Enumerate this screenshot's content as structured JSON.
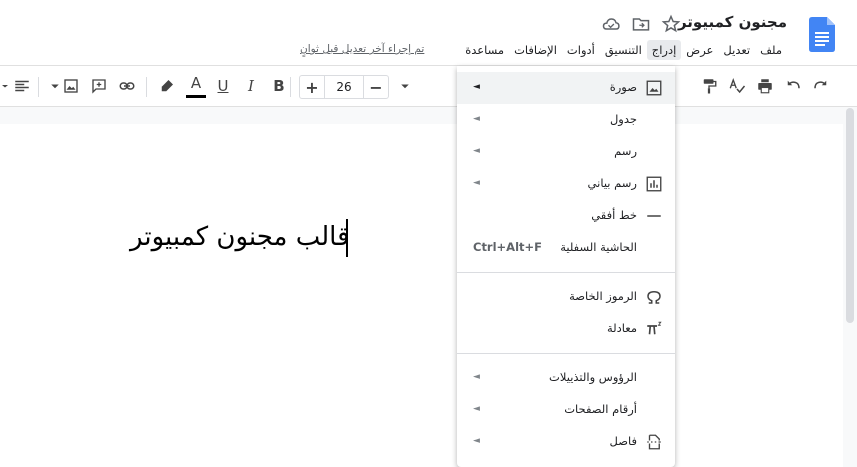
{
  "header": {
    "title": "مجنون كمبيوتر",
    "last_edit": "تم إجراء آخر تعديل قبل ثوانٍ"
  },
  "menu": {
    "items": [
      {
        "label": "ملف"
      },
      {
        "label": "تعديل"
      },
      {
        "label": "عرض"
      },
      {
        "label": "إدراج",
        "active": true
      },
      {
        "label": "التنسيق"
      },
      {
        "label": "أدوات"
      },
      {
        "label": "الإضافات"
      },
      {
        "label": "مساعدة"
      }
    ]
  },
  "toolbar": {
    "font_size": "26",
    "decrease_label": "−",
    "increase_label": "+",
    "bold_label": "B",
    "italic_label": "I",
    "underline_label": "U",
    "text_color_label": "A"
  },
  "document": {
    "body_text": "قالب مجنون كمبيوتر"
  },
  "insert_menu": {
    "items": [
      {
        "label": "صورة",
        "icon": "image-icon",
        "submenu": true
      },
      {
        "label": "جدول",
        "submenu": true
      },
      {
        "label": "رسم",
        "submenu": true
      },
      {
        "label": "رسم بياني",
        "icon": "chart-icon",
        "submenu": true
      },
      {
        "label": "خط أفقي",
        "icon": "horizontal-line-icon"
      },
      {
        "label": "الحاشية السفلية",
        "shortcut": "Ctrl+Alt+F"
      },
      {
        "label": "الرموز الخاصة",
        "icon": "omega-icon"
      },
      {
        "label": "معادلة",
        "icon": "pi-icon"
      },
      {
        "label": "الرؤوس والتذييلات",
        "submenu": true
      },
      {
        "label": "أرقام الصفحات",
        "submenu": true
      },
      {
        "label": "فاصل",
        "icon": "page-break-icon",
        "submenu": true
      }
    ],
    "submenu_arrow": "◄"
  },
  "colors": {
    "docs_blue": "#4285f4",
    "menu_highlight": "#f1f3f4"
  }
}
